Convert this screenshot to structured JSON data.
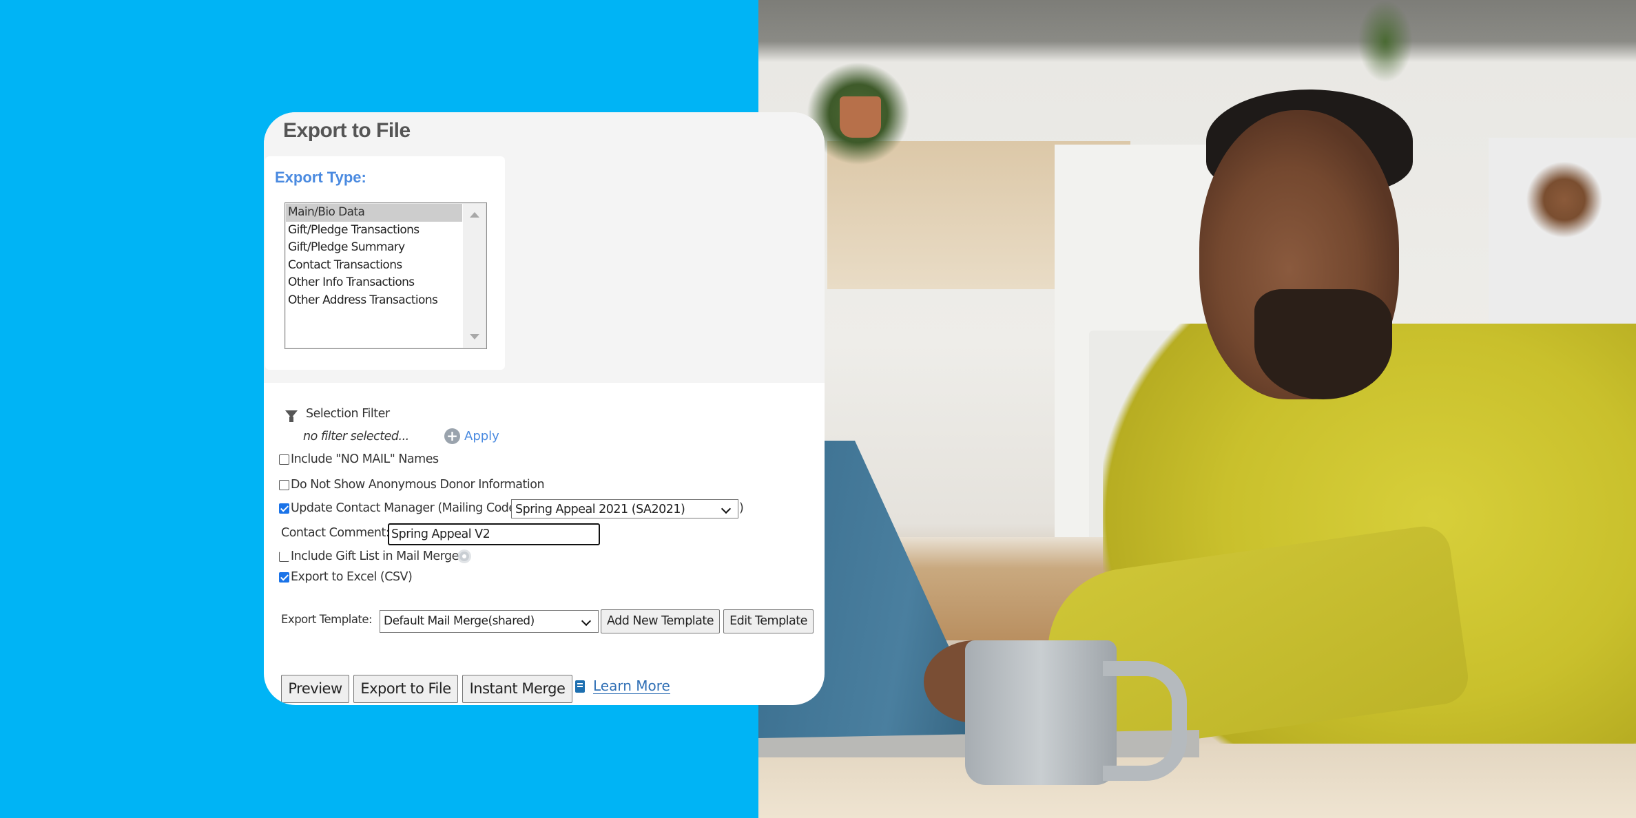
{
  "panel": {
    "title": "Export to File",
    "export_type": {
      "label": "Export Type:",
      "options": [
        "Main/Bio Data",
        "Gift/Pledge Transactions",
        "Gift/Pledge Summary",
        "Contact Transactions",
        "Other Info Transactions",
        "Other Address Transactions"
      ],
      "selected": "Main/Bio Data"
    },
    "selection_filter": {
      "label": "Selection Filter",
      "status": "no filter selected...",
      "apply_label": "Apply"
    },
    "options": {
      "no_mail": {
        "label": "Include \"NO MAIL\" Names",
        "checked": false
      },
      "anonymous": {
        "label": "Do Not Show Anonymous Donor Information",
        "checked": false
      },
      "update_contact": {
        "label": "Update Contact Manager (Mailing Code",
        "checked": true,
        "close_paren": ")"
      },
      "gift_list": {
        "label": "Include Gift List in Mail Merge",
        "checked": false
      },
      "excel": {
        "label": "Export to Excel (CSV)",
        "checked": true
      }
    },
    "mailing_code": {
      "value": "Spring Appeal 2021 (SA2021)"
    },
    "contact_comment": {
      "label": "Contact Comment:",
      "value": "Spring Appeal V2"
    },
    "export_template": {
      "label": "Export Template:",
      "value": "Default Mail Merge(shared)",
      "add_label": "Add New Template",
      "edit_label": "Edit Template"
    },
    "actions": {
      "preview": "Preview",
      "export": "Export to File",
      "instant_merge": "Instant Merge",
      "learn_more": "Learn More"
    }
  },
  "colors": {
    "background_blue": "#00b4f5",
    "accent_blue": "#4a8ae0",
    "checkbox_blue": "#1a73e8"
  }
}
